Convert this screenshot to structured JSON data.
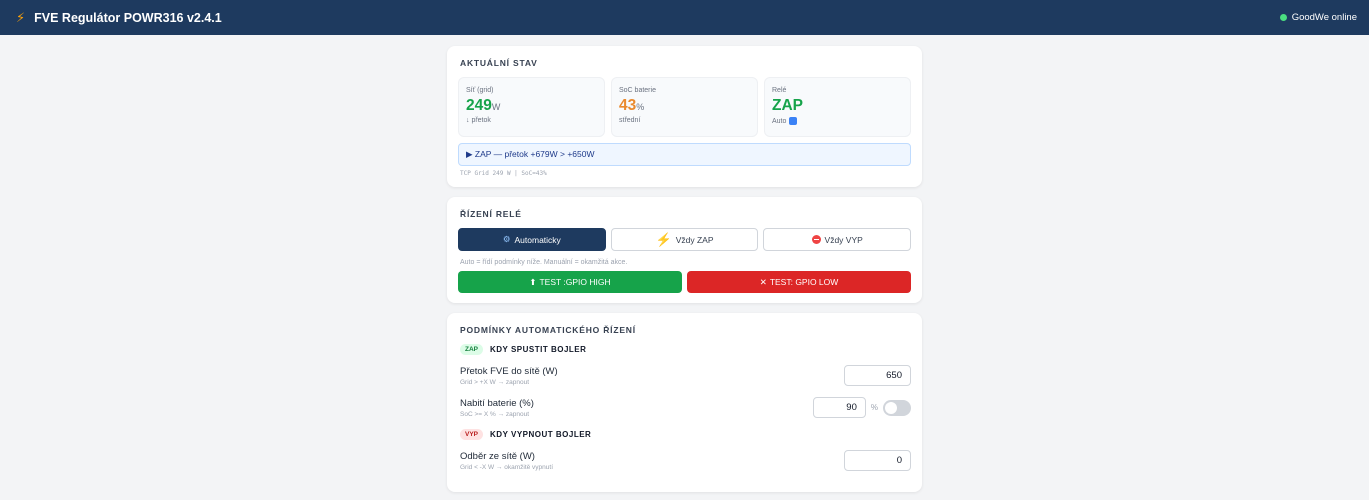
{
  "header": {
    "title": "FVE Regulátor POWR316 v2.4.1",
    "status": "GoodWe online"
  },
  "current_state": {
    "title": "AKTUÁLNÍ STAV",
    "grid": {
      "label": "Síť (grid)",
      "value": "249",
      "unit": "W",
      "sub": "↓ přetok"
    },
    "battery": {
      "label": "SoC baterie",
      "value": "43",
      "unit": "%",
      "sub": "střední"
    },
    "relay": {
      "label": "Relé",
      "value": "ZAP",
      "sub": "Auto"
    },
    "banner": "▶ ZAP — přetok +679W > +650W",
    "diagnostic": "TCP Grid 249 W  | SoC=43%"
  },
  "relay_control": {
    "title": "ŘÍZENÍ RELÉ",
    "modes": {
      "auto": "Automaticky",
      "always_on": "Vždy ZAP",
      "always_off": "Vždy VYP"
    },
    "hint": "Auto = řídí podmínky níže. Manuální = okamžitá akce.",
    "test_high": "TEST :GPIO HIGH",
    "test_low": "TEST: GPIO LOW"
  },
  "conditions": {
    "title": "PODMÍNKY AUTOMATICKÉHO ŘÍZENÍ",
    "on_section": {
      "badge": "ZAP",
      "title": "KDY SPUSTIT BOJLER"
    },
    "off_section": {
      "badge": "VYP",
      "title": "KDY VYPNOUT BOJLER"
    },
    "fields": {
      "export": {
        "name": "Přetok FVE do sítě (W)",
        "hint": "Grid > +X W → zapnout",
        "value": "650"
      },
      "battery": {
        "name": "Nabití baterie (%)",
        "hint": "SoC >= X % → zapnout",
        "value": "90",
        "unit": "%"
      },
      "import": {
        "name": "Odběr ze sítě (W)",
        "hint": "Grid < -X W → okamžitě vypnutí",
        "value": "0"
      }
    }
  }
}
